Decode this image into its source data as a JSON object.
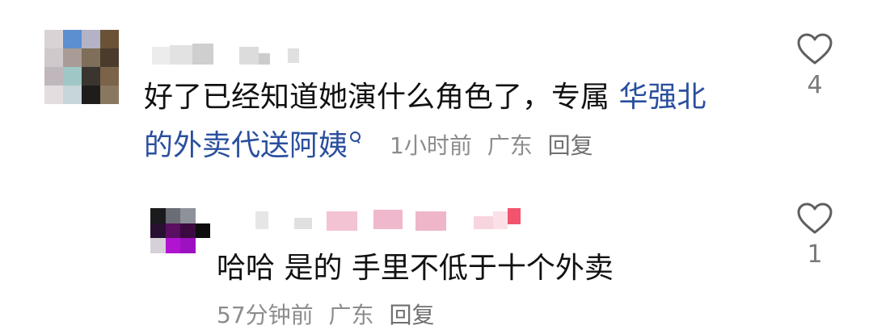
{
  "comments": [
    {
      "text_plain": "好了已经知道她演什么角色了，专属 ",
      "text_link_1": "华强北",
      "text_link_2": "的外卖代送阿姨",
      "time": "1小时前",
      "location": "广东",
      "reply_label": "回复",
      "likes": "4",
      "icon": "heart-outline-icon"
    },
    {
      "text_plain": "哈哈 是的  手里不低于十个外卖",
      "time": "57分钟前",
      "location": "广东",
      "reply_label": "回复",
      "likes": "1",
      "icon": "heart-outline-icon"
    }
  ],
  "colors": {
    "link": "#2a4f9e",
    "text": "#111111",
    "meta": "#8c8c8c"
  }
}
